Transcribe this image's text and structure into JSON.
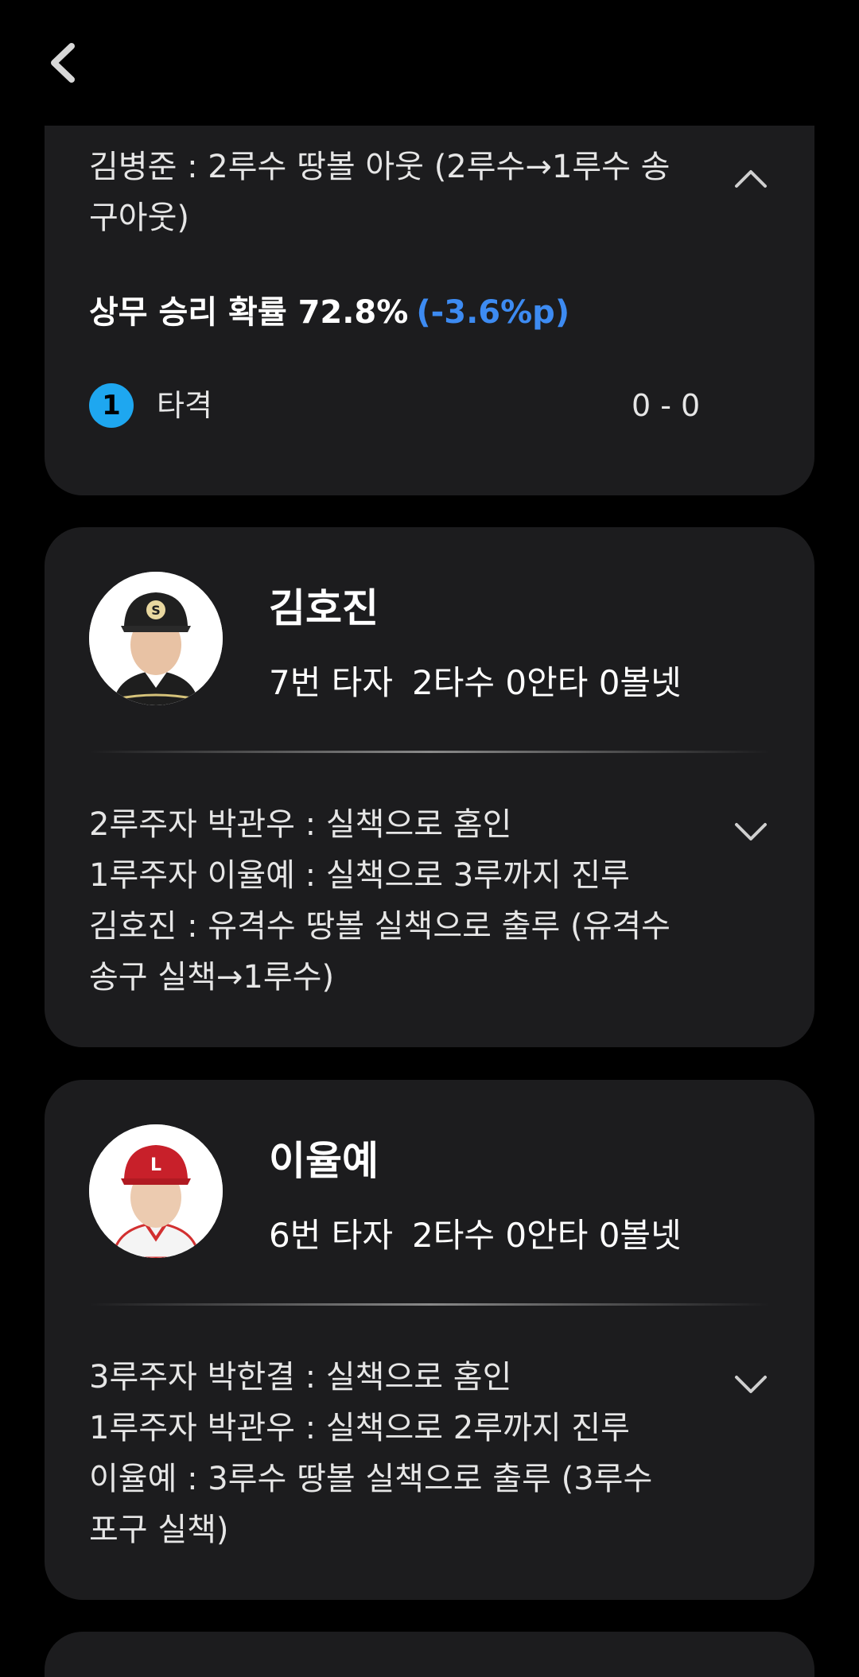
{
  "colors": {
    "background": "#000000",
    "card": "#1c1c1e",
    "accent_blue": "#3d8bf2",
    "badge_blue": "#1ea7f0"
  },
  "top_bar": {
    "back_icon": "chevron-left-icon"
  },
  "card1": {
    "play_text": "김병준 : 2루수 땅볼 아웃 (2루수→1루수 송\n구아웃)",
    "expand_icon": "chevron-up-icon",
    "probability_label": "상무 승리 확률 72.8%",
    "probability_delta": "(-3.6%p)",
    "pitch": {
      "number": "1",
      "type": "타격",
      "count": "0 - 0"
    }
  },
  "card2": {
    "player_name": "김호진",
    "batting_order": "7번 타자",
    "stats": "2타수 0안타 0볼넷",
    "events": [
      "2루주자 박관우 : 실책으로 홈인",
      "1루주자 이율예 : 실책으로 3루까지 진루",
      "김호진 : 유격수 땅볼 실책으로 출루 (유격수\n송구 실책→1루수)"
    ],
    "expand_icon": "chevron-down-icon"
  },
  "card3": {
    "player_name": "이율예",
    "batting_order": "6번 타자",
    "stats": "2타수 0안타 0볼넷",
    "events": [
      "3루주자 박한결 : 실책으로 홈인",
      "1루주자 박관우 : 실책으로 2루까지 진루",
      "이율예 : 3루수 땅볼 실책으로 출루 (3루수\n포구 실책)"
    ],
    "expand_icon": "chevron-down-icon"
  }
}
